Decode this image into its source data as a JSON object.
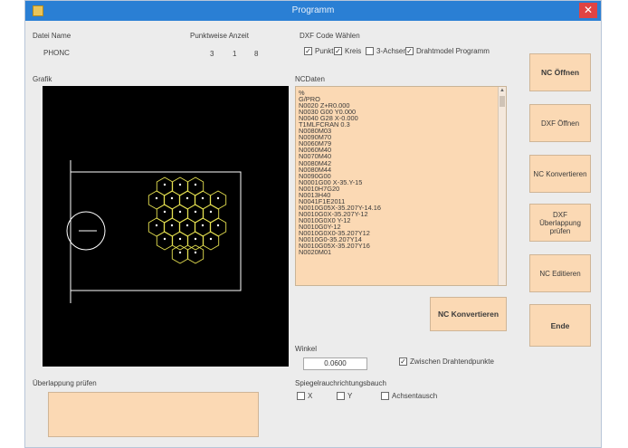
{
  "window": {
    "title": "Programm",
    "close_glyph": "✕"
  },
  "labels": {
    "dateiname": "Datei Name",
    "punktweise": "Punktweise Anzeit",
    "dxf_code": "DXF Code Wählen",
    "grafik": "Grafik",
    "nc_daten": "NCDaten",
    "winkel": "Winkel",
    "spiegel": "Spiegelrauchrichtungsbauch",
    "ueberlappung": "Überlappung prüfen"
  },
  "file_name": "PHONC",
  "point_values": [
    "3",
    "1",
    "8"
  ],
  "dxf_options": [
    {
      "label": "Punkt",
      "checked": true
    },
    {
      "label": "Kreis",
      "checked": true
    },
    {
      "label": "3-Achsen",
      "checked": false
    },
    {
      "label": "Drahtmodel Programm",
      "checked": true
    }
  ],
  "nc_lines": [
    "%",
    "G/PRO",
    "N0020 Z+R0.000",
    "N0030 G00 Y0.000",
    "N0040 G28 X-0.000",
    "T1MLFCRAN 0.3",
    "N0080M03",
    "N0090M70",
    "N0060M79",
    "N0060M40",
    "N0070M40",
    "N0080M42",
    "N0080M44",
    "N0090G00",
    "N0001G00 X-35.Y-15",
    "N0010H7G20",
    "N0013H40",
    "N0041F1E2011",
    "N0010G05X-35.207Y-14.16",
    "N0010G0X-35.207Y-12",
    "N0010G0X0 Y-12",
    "N0010G0Y-12",
    "N0010G0X0-35.207Y12",
    "N0010G0-35.207Y14",
    "N0010G05X-35.207Y16",
    "N0020M01"
  ],
  "buttons": {
    "nc_oeffnen": "NC Öffnen",
    "dxf_oeffnen": "DXF Öffnen",
    "nc_konvertieren": "NC Konvertieren",
    "dxf_ueberlappung_1": "DXF",
    "dxf_ueberlappung_2": "Überlappung prüfen",
    "nc_editieren": "NC Editieren",
    "ende": "Ende",
    "nc_konvertieren_main": "NC Konvertieren"
  },
  "winkel_value": "0.0600",
  "zwischen_option": {
    "label": "Zwischen Drahtendpunkte",
    "checked": true
  },
  "mirror_options": [
    {
      "label": "X",
      "checked": false
    },
    {
      "label": "Y",
      "checked": false
    },
    {
      "label": "Achsentausch",
      "checked": false
    }
  ],
  "check_glyph": "✓",
  "colors": {
    "titlebar": "#2a7fd4",
    "button_fill": "#fbd9b4",
    "canvas": "#000000",
    "drawing_white": "#ffffff",
    "drawing_yellow": "#e5e050"
  }
}
